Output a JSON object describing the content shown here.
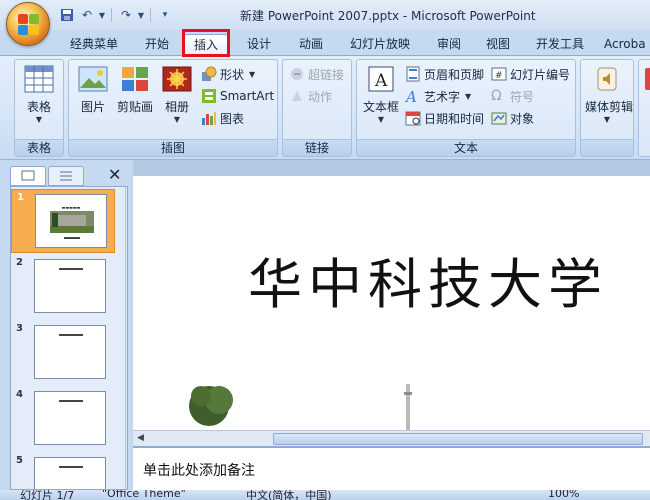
{
  "window": {
    "title": "新建 PowerPoint 2007.pptx - Microsoft PowerPoint"
  },
  "tabs": [
    {
      "label": "经典菜单"
    },
    {
      "label": "开始"
    },
    {
      "label": "插入"
    },
    {
      "label": "设计"
    },
    {
      "label": "动画"
    },
    {
      "label": "幻灯片放映"
    },
    {
      "label": "审阅"
    },
    {
      "label": "视图"
    },
    {
      "label": "开发工具"
    },
    {
      "label": "Acroba"
    }
  ],
  "active_tab": "插入",
  "highlight_color": "#e8101f",
  "ribbon": {
    "groups": {
      "table": {
        "label": "表格",
        "buttons": {
          "table": "表格"
        }
      },
      "illustrations": {
        "label": "插图",
        "buttons": {
          "picture": "图片",
          "clipart": "剪贴画",
          "album": "相册",
          "shapes": "形状",
          "smartart": "SmartArt",
          "chart": "图表"
        }
      },
      "links": {
        "label": "链接",
        "buttons": {
          "hyperlink": "超链接",
          "action": "动作"
        }
      },
      "text": {
        "label": "文本",
        "buttons": {
          "textbox": "文本框",
          "header_footer": "页眉和页脚",
          "wordart": "艺术字",
          "datetime": "日期和时间",
          "slide_number": "幻灯片编号",
          "symbol": "符号",
          "object": "对象"
        }
      },
      "media": {
        "buttons": {
          "media_clip": "媒体剪辑"
        }
      }
    }
  },
  "slides_panel": {
    "slides": [
      {
        "number": "1",
        "selected": true
      },
      {
        "number": "2"
      },
      {
        "number": "3"
      },
      {
        "number": "4"
      },
      {
        "number": "5"
      }
    ]
  },
  "slide": {
    "title": "华中科技大学"
  },
  "notes": {
    "placeholder": "单击此处添加备注"
  },
  "status": {
    "slide_info": "幻灯片 1/7",
    "theme": "\"Office Theme\"",
    "language": "中文(简体，中国)",
    "zoom": "100%"
  }
}
